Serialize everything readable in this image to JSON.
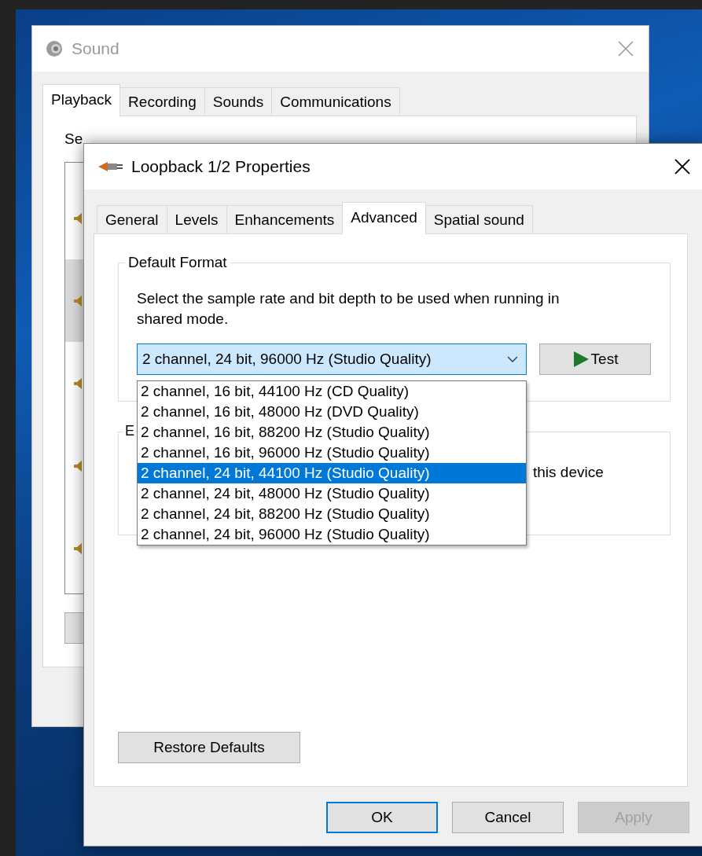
{
  "sound_window": {
    "title": "Sound",
    "tabs": [
      {
        "label": "Playback",
        "selected": true
      },
      {
        "label": "Recording",
        "selected": false
      },
      {
        "label": "Sounds",
        "selected": false
      },
      {
        "label": "Communications",
        "selected": false
      }
    ],
    "instruction": "Se",
    "devices": [
      {
        "selected": false
      },
      {
        "selected": true
      },
      {
        "selected": false
      },
      {
        "selected": false
      },
      {
        "selected": false
      }
    ]
  },
  "properties_dialog": {
    "title": "Loopback 1/2 Properties",
    "tabs": [
      {
        "label": "General",
        "selected": false
      },
      {
        "label": "Levels",
        "selected": false
      },
      {
        "label": "Enhancements",
        "selected": false
      },
      {
        "label": "Advanced",
        "selected": true
      },
      {
        "label": "Spatial sound",
        "selected": false
      }
    ],
    "default_format": {
      "legend": "Default Format",
      "description": "Select the sample rate and bit depth to be used when running in shared mode.",
      "combo": {
        "value": "2 channel, 24 bit, 96000 Hz (Studio Quality)",
        "expanded": true
      },
      "options": [
        {
          "label": "2 channel, 16 bit, 44100 Hz (CD Quality)",
          "selected": false
        },
        {
          "label": "2 channel, 16 bit, 48000 Hz (DVD Quality)",
          "selected": false
        },
        {
          "label": "2 channel, 16 bit, 88200 Hz (Studio Quality)",
          "selected": false
        },
        {
          "label": "2 channel, 16 bit, 96000 Hz (Studio Quality)",
          "selected": false
        },
        {
          "label": "2 channel, 24 bit, 44100 Hz (Studio Quality)",
          "selected": true
        },
        {
          "label": "2 channel, 24 bit, 48000 Hz (Studio Quality)",
          "selected": false
        },
        {
          "label": "2 channel, 24 bit, 88200 Hz (Studio Quality)",
          "selected": false
        },
        {
          "label": "2 channel, 24 bit, 96000 Hz (Studio Quality)",
          "selected": false
        }
      ],
      "test_button": "Test"
    },
    "exclusive_mode": {
      "legend": "E",
      "text": "this device"
    },
    "restore_button": "Restore Defaults",
    "buttons": [
      {
        "label": "OK",
        "kind": "default"
      },
      {
        "label": "Cancel",
        "kind": "normal"
      },
      {
        "label": "Apply",
        "kind": "disabled"
      }
    ]
  }
}
